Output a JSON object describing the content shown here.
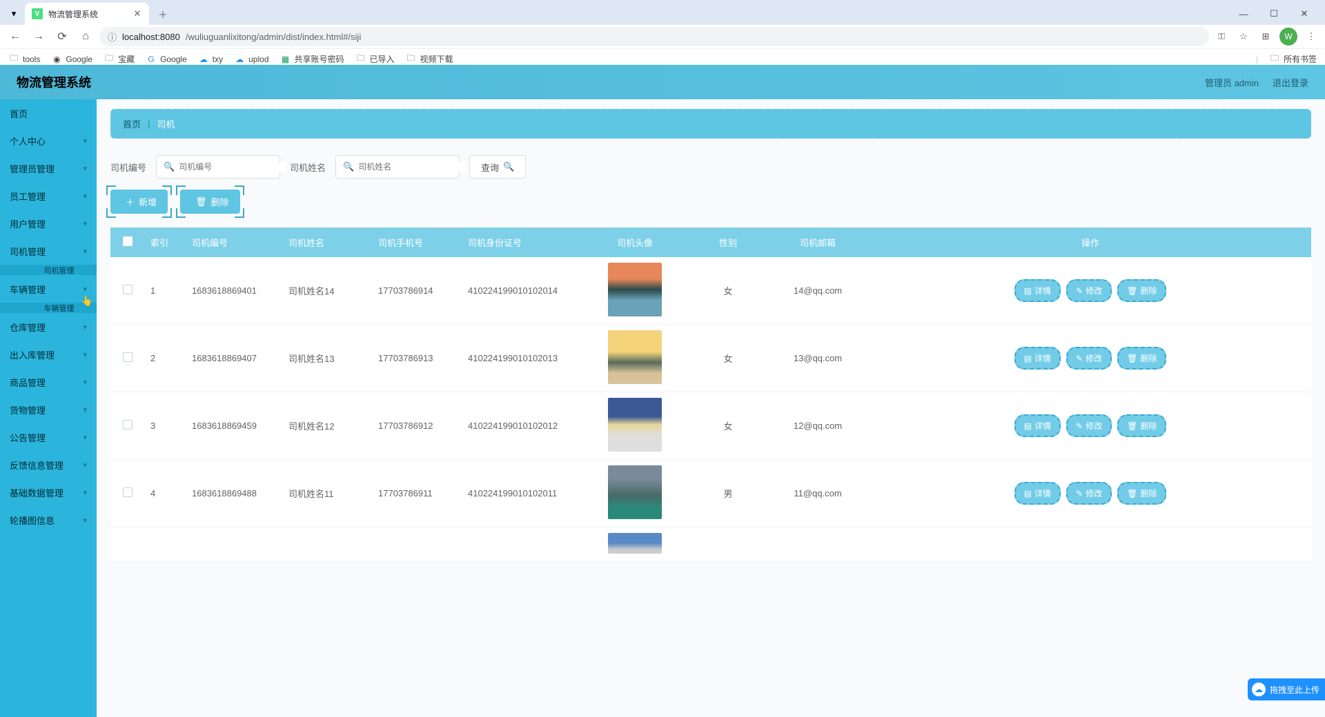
{
  "browser": {
    "tab": {
      "title": "物流管理系统"
    },
    "url": {
      "scheme_host": "localhost:8080",
      "path": "/wuliuguanlixitong/admin/dist/index.html#/siji"
    },
    "bookmarks": [
      "tools",
      "Google",
      "宝藏",
      "Google",
      "txy",
      "uplod",
      "共享账号密码",
      "已导入",
      "视频下载"
    ],
    "allbookmarks_label": "所有书签",
    "avatar_letter": "W"
  },
  "app": {
    "title": "物流管理系统",
    "user_label": "管理员 admin",
    "logout_label": "退出登录"
  },
  "sidebar": {
    "items": [
      {
        "label": "首页",
        "expandable": false
      },
      {
        "label": "个人中心",
        "expandable": true
      },
      {
        "label": "管理员管理",
        "expandable": true
      },
      {
        "label": "员工管理",
        "expandable": true
      },
      {
        "label": "用户管理",
        "expandable": true
      },
      {
        "label": "司机管理",
        "expandable": true,
        "sub": "司机管理"
      },
      {
        "label": "车辆管理",
        "expandable": true,
        "sub": "车辆管理"
      },
      {
        "label": "仓库管理",
        "expandable": true
      },
      {
        "label": "出入库管理",
        "expandable": true
      },
      {
        "label": "商品管理",
        "expandable": true
      },
      {
        "label": "货物管理",
        "expandable": true
      },
      {
        "label": "公告管理",
        "expandable": true
      },
      {
        "label": "反馈信息管理",
        "expandable": true
      },
      {
        "label": "基础数据管理",
        "expandable": true
      },
      {
        "label": "轮播图信息",
        "expandable": true
      }
    ]
  },
  "breadcrumb": {
    "home": "首页",
    "current": "司机"
  },
  "search": {
    "label_code": "司机编号",
    "placeholder_code": "司机编号",
    "label_name": "司机姓名",
    "placeholder_name": "司机姓名",
    "query_label": "查询"
  },
  "actions": {
    "add_label": "新增",
    "delete_label": "删除"
  },
  "table": {
    "headers": {
      "index": "索引",
      "code": "司机编号",
      "name": "司机姓名",
      "phone": "司机手机号",
      "idcard": "司机身份证号",
      "avatar": "司机头像",
      "gender": "性别",
      "email": "司机邮箱",
      "ops": "操作"
    },
    "row_actions": {
      "detail": "详情",
      "edit": "修改",
      "del": "删除"
    },
    "rows": [
      {
        "index": "1",
        "code": "1683618869401",
        "name": "司机姓名14",
        "phone": "17703786914",
        "idcard": "410224199010102014",
        "gender": "女",
        "email": "14@qq.com"
      },
      {
        "index": "2",
        "code": "1683618869407",
        "name": "司机姓名13",
        "phone": "17703786913",
        "idcard": "410224199010102013",
        "gender": "女",
        "email": "13@qq.com"
      },
      {
        "index": "3",
        "code": "1683618869459",
        "name": "司机姓名12",
        "phone": "17703786912",
        "idcard": "410224199010102012",
        "gender": "女",
        "email": "12@qq.com"
      },
      {
        "index": "4",
        "code": "1683618869488",
        "name": "司机姓名11",
        "phone": "17703786911",
        "idcard": "410224199010102011",
        "gender": "男",
        "email": "11@qq.com"
      }
    ]
  },
  "float_upload": "拖拽至此上传"
}
